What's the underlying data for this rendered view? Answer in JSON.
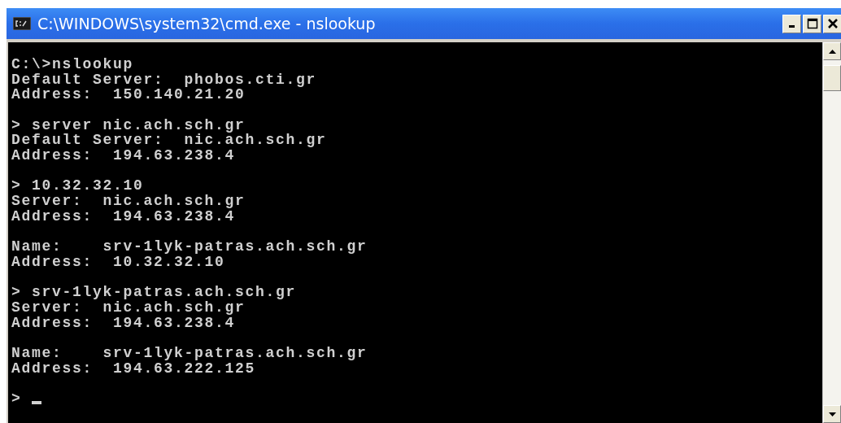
{
  "window": {
    "title": "C:\\WINDOWS\\system32\\cmd.exe - nslookup"
  },
  "console": {
    "blocks": [
      {
        "lines": [
          "C:\\>nslookup",
          "Default Server:  phobos.cti.gr",
          "Address:  150.140.21.20"
        ]
      },
      {
        "lines": [
          "> server nic.ach.sch.gr",
          "Default Server:  nic.ach.sch.gr",
          "Address:  194.63.238.4"
        ]
      },
      {
        "lines": [
          "> 10.32.32.10",
          "Server:  nic.ach.sch.gr",
          "Address:  194.63.238.4"
        ]
      },
      {
        "lines": [
          "Name:    srv-1lyk-patras.ach.sch.gr",
          "Address:  10.32.32.10"
        ]
      },
      {
        "lines": [
          "> srv-1lyk-patras.ach.sch.gr",
          "Server:  nic.ach.sch.gr",
          "Address:  194.63.238.4"
        ]
      },
      {
        "lines": [
          "Name:    srv-1lyk-patras.ach.sch.gr",
          "Address:  194.63.222.125"
        ]
      },
      {
        "lines": [
          ">"
        ],
        "cursor": true
      }
    ]
  }
}
